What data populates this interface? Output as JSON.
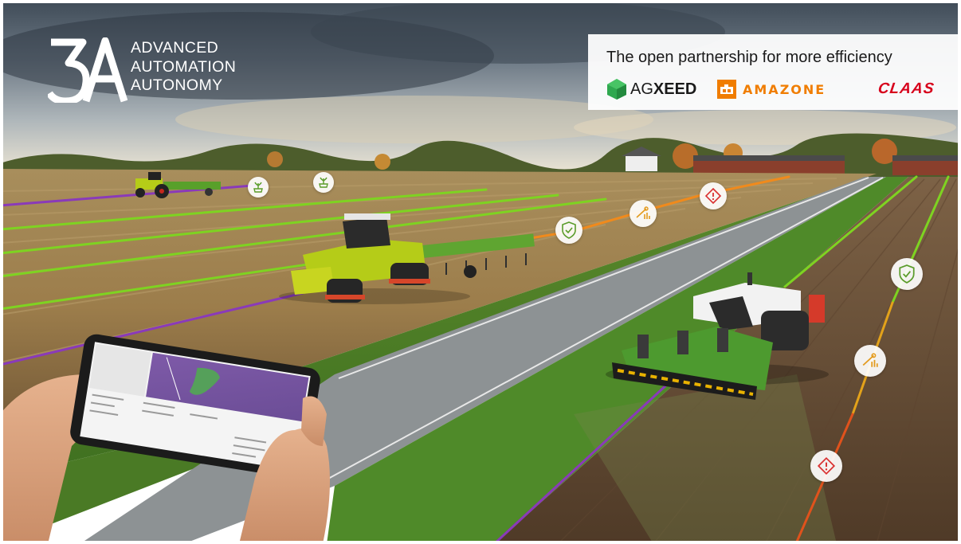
{
  "logo": {
    "mark": "3A",
    "lines": [
      "ADVANCED",
      "AUTOMATION",
      "AUTONOMY"
    ]
  },
  "partners": {
    "headline": "The open partnership for more efficiency",
    "agxeed": {
      "prefix": "AG",
      "suffix": "XEED"
    },
    "amazone": "AMAZONE",
    "claas": "CLAAS"
  },
  "colors": {
    "agxeed_green": "#2fa84f",
    "amazone_orange": "#f07d00",
    "claas_red": "#d7001b",
    "claas_tractor_green": "#b5cc18",
    "line_green": "#7ed321",
    "line_purple": "#8a3ab9",
    "line_orange": "#f08a1c",
    "alert_red": "#d93030"
  },
  "badges": [
    {
      "icon": "crop-icon"
    },
    {
      "icon": "crop-icon"
    },
    {
      "icon": "shield-check-icon"
    },
    {
      "icon": "speed-gauge-icon"
    },
    {
      "icon": "warning-icon"
    },
    {
      "icon": "shield-check-icon"
    },
    {
      "icon": "speed-gauge-icon"
    },
    {
      "icon": "warning-icon"
    }
  ]
}
